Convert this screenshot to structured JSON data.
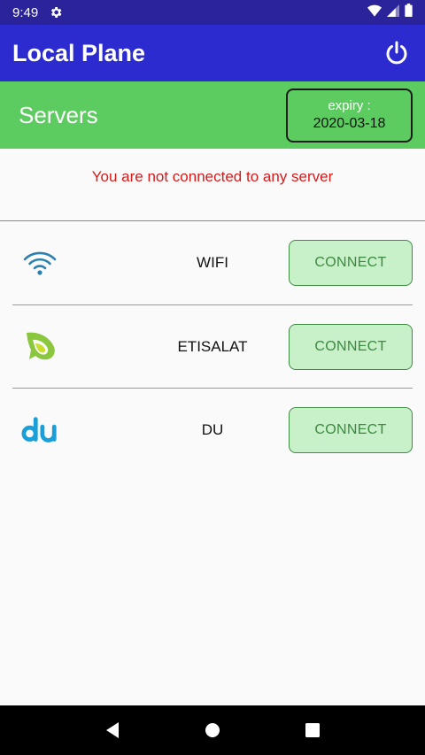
{
  "status_bar": {
    "time": "9:49",
    "icons": [
      "settings-gear-icon",
      "wifi-icon",
      "cell-signal-icon",
      "battery-icon"
    ],
    "color": "#2a2399"
  },
  "app_bar": {
    "title": "Local Plane",
    "action_icon": "power-icon",
    "color": "#2b2bcf"
  },
  "servers_header": {
    "title": "Servers",
    "expiry_label": "expiry :",
    "expiry_date": "2020-03-18",
    "color": "#5ccb60"
  },
  "connection_status": {
    "message": "You are not connected to any server",
    "color": "#d81a1a"
  },
  "servers": [
    {
      "name": "WIFI",
      "icon": "wifi-icon",
      "button_label": "CONNECT"
    },
    {
      "name": "ETISALAT",
      "icon": "etisalat-logo-icon",
      "button_label": "CONNECT"
    },
    {
      "name": "DU",
      "icon": "du-logo-icon",
      "button_label": "CONNECT"
    }
  ],
  "nav_bar": {
    "icons": [
      "back-icon",
      "home-icon",
      "recents-icon"
    ]
  }
}
